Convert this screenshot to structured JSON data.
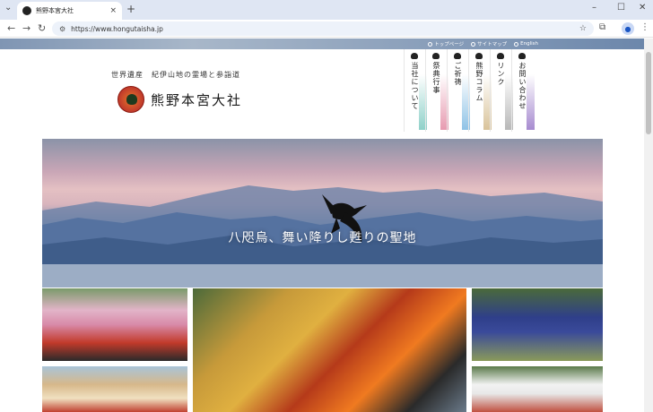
{
  "browser": {
    "tab_title": "熊野本宮大社",
    "tab_close": "×",
    "new_tab": "+",
    "url": "https://www.hongutaisha.jp",
    "nav": {
      "back": "←",
      "forward": "→",
      "reload": "↻"
    },
    "window": {
      "minimize": "–",
      "maximize": "☐",
      "close": "✕"
    },
    "tune_icon": "⚙",
    "star_icon": "☆",
    "extensions_icon": "⧉",
    "menu_icon": "⋮",
    "profile_icon": "●",
    "tab_list_icon": "⌄"
  },
  "site": {
    "top_links": [
      "トップページ",
      "サイトマップ",
      "English"
    ],
    "tagline": "世界遺産　紀伊山地の霊場と参詣道",
    "logo_text": "熊野本宮大社",
    "global_nav": [
      {
        "label": "当社について",
        "color": "#8fd1c9"
      },
      {
        "label": "祭典行事",
        "color": "#e79ab0"
      },
      {
        "label": "ご祈祷",
        "color": "#8fc3e6"
      },
      {
        "label": "熊野コラム",
        "color": "#d9c39a"
      },
      {
        "label": "リンク",
        "color": "#b8b8b8"
      },
      {
        "label": "お問い合わせ",
        "color": "#a78bd0"
      }
    ],
    "hero_title": "八咫烏、舞い降りし甦りの聖地"
  }
}
